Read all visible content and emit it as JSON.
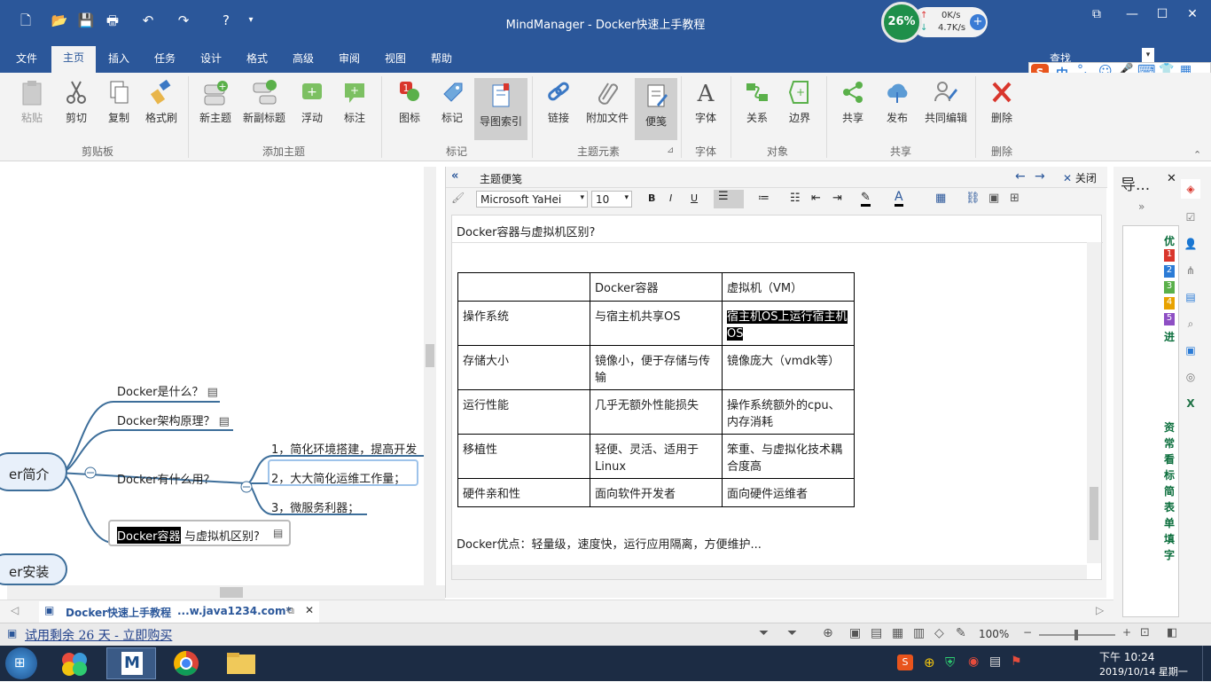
{
  "window": {
    "title": "MindManager - Docker快速上手教程",
    "speed": {
      "percent": "26%",
      "up": "0K/s",
      "down": "4.7K/s"
    },
    "search_label": "查找"
  },
  "menu": {
    "tabs": [
      "文件",
      "主页",
      "插入",
      "任务",
      "设计",
      "格式",
      "高级",
      "审阅",
      "视图",
      "帮助"
    ],
    "active": "主页"
  },
  "ribbon": {
    "buttons": {
      "paste": "粘贴",
      "cut": "剪切",
      "copy": "复制",
      "format_painter": "格式刷",
      "new_topic": "新主题",
      "new_subtopic": "新副标题",
      "floating": "浮动",
      "callout": "标注",
      "icons": "图标",
      "tags": "标记",
      "map_index": "导图索引",
      "link": "链接",
      "attach": "附加文件",
      "notes": "便笺",
      "font": "字体",
      "relationship": "关系",
      "boundary": "边界",
      "share": "共享",
      "publish": "发布",
      "co_edit": "共同编辑",
      "delete": "删除"
    },
    "groups": {
      "clipboard": "剪贴板",
      "add_topic": "添加主题",
      "marks": "标记",
      "topic_elements": "主题元素",
      "font": "字体",
      "objects": "对象",
      "share": "共享",
      "delete": "删除"
    }
  },
  "map": {
    "central_partial": "er简介",
    "install_partial": "er安装",
    "topics": [
      "Docker是什么？",
      "Docker架构原理？",
      "Docker有什么用？"
    ],
    "subtopics": [
      "1，简化环境搭建，提高开发",
      "2，大大简化运维工作量；",
      "3，微服务利器；"
    ],
    "selected_topic_highlight": "Docker容器",
    "selected_topic_rest": "与虚拟机区别?"
  },
  "notes_panel": {
    "header": "主题便笺",
    "close": "关闭",
    "font_name": "Microsoft YaHei",
    "font_size": "10",
    "topic_title": "Docker容器与虚拟机区别?",
    "table": {
      "header": [
        "",
        "Docker容器",
        "虚拟机（VM）"
      ],
      "rows": [
        [
          "操作系统",
          "与宿主机共享OS",
          "宿主机OS上运行宿主机OS"
        ],
        [
          "存储大小",
          "镜像小，便于存储与传输",
          "镜像庞大（vmdk等）"
        ],
        [
          "运行性能",
          "几乎无额外性能损失",
          "操作系统额外的cpu、内存消耗"
        ],
        [
          "移植性",
          "轻便、灵活、适用于Linux",
          "笨重、与虚拟化技术耦合度高"
        ],
        [
          "硬件亲和性",
          "面向软件开发者",
          "面向硬件运维者"
        ]
      ]
    },
    "footer_text": "Docker优点：轻量级，速度快，运行应用隔离，方便维护..."
  },
  "side_panel": {
    "title": "导...",
    "labels": [
      "优",
      "进",
      "资",
      "常",
      "看",
      "标",
      "简",
      "表",
      "单",
      "填",
      "字"
    ],
    "priorities": [
      "1",
      "2",
      "3",
      "4",
      "5"
    ]
  },
  "doc_tab": {
    "name": "Docker快速上手教程",
    "site": "...w.java1234.com*"
  },
  "status": {
    "trial": "试用剩余 26 天 - 立即购买",
    "zoom": "100%"
  },
  "taskbar": {
    "time": "下午 10:24",
    "date": "2019/10/14 星期一",
    "ime": "中"
  }
}
